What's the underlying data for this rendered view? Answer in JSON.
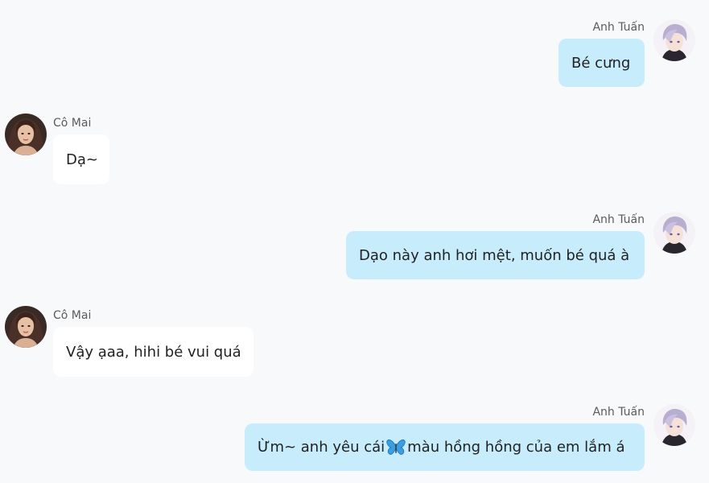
{
  "conversation": {
    "messages": [
      {
        "sender": "Anh Tuấn",
        "text": "Bé cưng",
        "side": "right"
      },
      {
        "sender": "Cô Mai",
        "text": "Dạ~",
        "side": "left"
      },
      {
        "sender": "Anh Tuấn",
        "text": "Dạo này anh hơi mệt, muốn bé quá à",
        "side": "right"
      },
      {
        "sender": "Cô Mai",
        "text": "Vậy ạaa, hihi bé vui quá",
        "side": "left"
      },
      {
        "sender": "Anh Tuấn",
        "text_before": "Ừm~ anh yêu cái",
        "emoji_icon": "butterfly-emoji",
        "text_after": "màu hồng hồng của em lắm á",
        "side": "right"
      }
    ]
  },
  "colors": {
    "background": "#f8f9fa",
    "outgoing_bubble": "#c7ecfc",
    "incoming_bubble": "#ffffff",
    "sender_name": "#5b5b5b"
  }
}
